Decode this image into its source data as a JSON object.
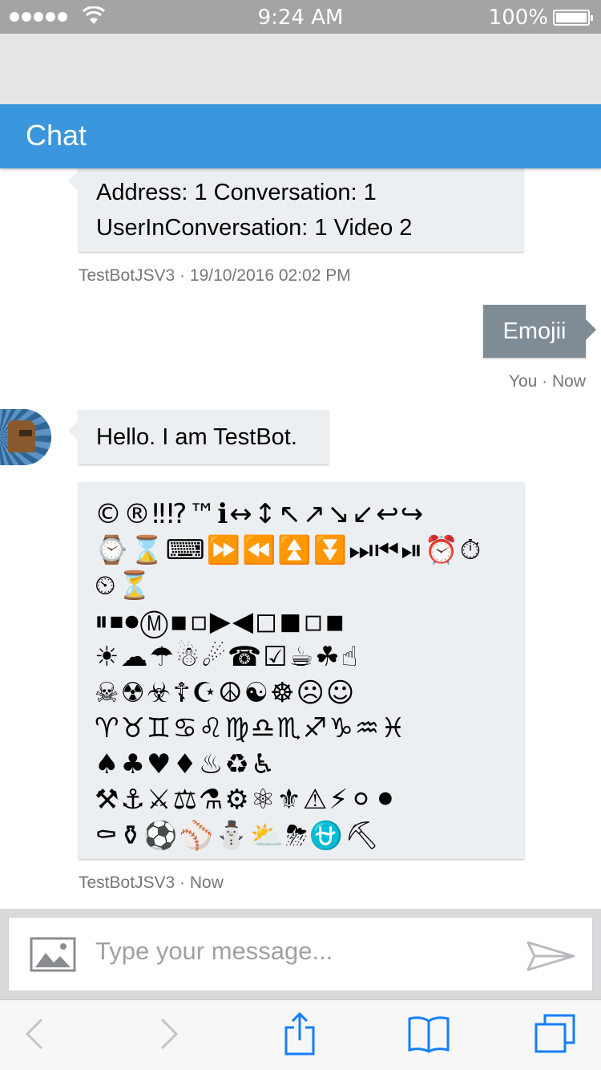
{
  "status_bar": {
    "time": "9:24 AM",
    "battery": "100%"
  },
  "header": {
    "title": "Chat"
  },
  "messages": [
    {
      "from": "bot",
      "lines": [
        "Address: 1 Conversation: 1",
        "UserInConversation: 1 Video 2"
      ],
      "meta": "TestBotJSV3 · 19/10/2016 02:02 PM"
    },
    {
      "from": "user",
      "text": "Emojii",
      "meta": "You · Now"
    },
    {
      "from": "bot",
      "text": "Hello. I am TestBot."
    },
    {
      "from": "bot",
      "emoji_lines": [
        "©®‼⁉™ℹ↔↕↖↗↘↙↩↪",
        "⌚⌛⌨⏩⏪⏫⏬⏭⏮⏯⏰⏱",
        "⏲⏳",
        "⏸⏹⏺Ⓜ▪▫▶◀◻◼◽◾",
        "☀☁☂☃☄☎☑☕☘☝",
        "☠☢☣☦☪☮☯☸☹☺",
        "♈♉♊♋♌♍♎♏♐♑♒♓",
        "♠♣♥♦♨♻♿",
        "⚒⚓⚔⚖⚗⚙⚛⚜⚠⚡⚪⚫",
        "⚰⚱⚽⚾⛄⛅⛈⛎⛏"
      ],
      "meta": "TestBotJSV3 · Now"
    }
  ],
  "input": {
    "placeholder": "Type your message..."
  },
  "icons": {
    "image": "image-upload-icon",
    "send": "send-icon",
    "back": "back-chevron-icon",
    "forward": "forward-chevron-icon",
    "share": "share-icon",
    "bookmarks": "bookmarks-icon",
    "tabs": "tabs-icon"
  },
  "colors": {
    "header": "#3a96dd",
    "user_bubble": "#808c95",
    "bot_bubble": "#eceff1",
    "ios_blue": "#157efb"
  }
}
